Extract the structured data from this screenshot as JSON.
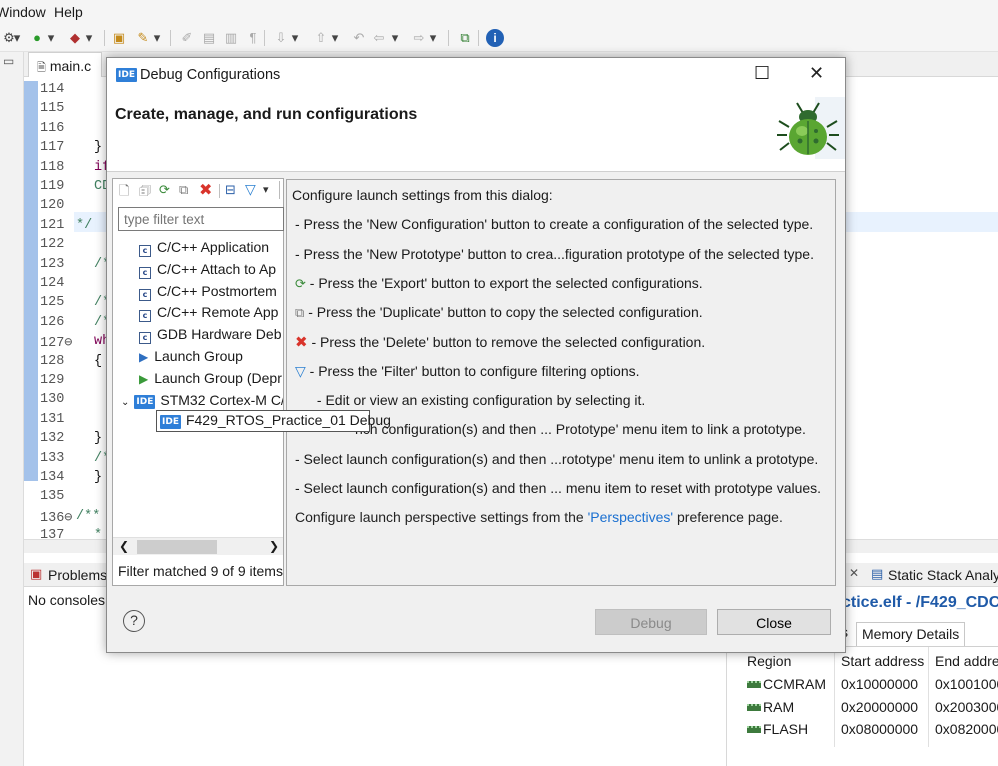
{
  "menu": {
    "window": "Window",
    "help": "Help"
  },
  "editor": {
    "tab": "main.c",
    "lines": [
      {
        "n": "114",
        "code": ""
      },
      {
        "n": "115",
        "code": ""
      },
      {
        "n": "116",
        "code": ""
      },
      {
        "n": "117",
        "code": "}"
      },
      {
        "n": "118",
        "code": "if"
      },
      {
        "n": "119",
        "code": "CD"
      },
      {
        "n": "120",
        "code": ""
      },
      {
        "n": "121",
        "code": "*/"
      },
      {
        "n": "122",
        "code": ""
      },
      {
        "n": "123",
        "code": "/*"
      },
      {
        "n": "124",
        "code": ""
      },
      {
        "n": "125",
        "code": "/*"
      },
      {
        "n": "126",
        "code": "/*"
      },
      {
        "n": "127⊖",
        "code": "wh"
      },
      {
        "n": "128",
        "code": "{"
      },
      {
        "n": "129",
        "code": ""
      },
      {
        "n": "130",
        "code": ""
      },
      {
        "n": "131",
        "code": ""
      },
      {
        "n": "132",
        "code": "}"
      },
      {
        "n": "133",
        "code": "/*"
      },
      {
        "n": "134",
        "code": "}"
      },
      {
        "n": "135",
        "code": ""
      },
      {
        "n": "136⊖",
        "code": "/**"
      },
      {
        "n": "137",
        "code": "*"
      }
    ]
  },
  "bottom_left": {
    "tab": "Problems",
    "message": "No consoles"
  },
  "bottom_right": {
    "tab": "Static Stack Analy",
    "title": "ctice.elf - /F429_CDC",
    "subtabs": [
      "s",
      "Memory Details"
    ],
    "headers": [
      "Region",
      "Start address",
      "End addre"
    ],
    "rows": [
      [
        "CCMRAM",
        "0x10000000",
        "0x1001000"
      ],
      [
        "RAM",
        "0x20000000",
        "0x2003000"
      ],
      [
        "FLASH",
        "0x08000000",
        "0x0820000"
      ]
    ]
  },
  "dialog": {
    "title": "Debug Configurations",
    "header": "Create, manage, and run configurations",
    "filter_placeholder": "type filter text",
    "tree": [
      {
        "label": "C/C++ Application",
        "kind": "cfg"
      },
      {
        "label": "C/C++ Attach to Ap",
        "kind": "cfg"
      },
      {
        "label": "C/C++ Postmortem",
        "kind": "cfg"
      },
      {
        "label": "C/C++ Remote App",
        "kind": "cfg"
      },
      {
        "label": "GDB Hardware Deb",
        "kind": "cfg"
      },
      {
        "label": "Launch Group",
        "kind": "launch"
      },
      {
        "label": "Launch Group (Depr",
        "kind": "launch2"
      },
      {
        "label": "STM32 Cortex-M C/",
        "kind": "ide"
      }
    ],
    "selected_item": "F429_RTOS_Practice_01 Debug",
    "filter_status": "Filter matched 9 of 9 items",
    "info": [
      "Configure launch settings from this dialog:",
      "- Press the 'New Configuration' button to create a configuration of the selected type.",
      "- Press the 'New Prototype' button to crea...figuration prototype of the selected type.",
      "- Press the 'Export' button to export the selected configurations.",
      "- Press the 'Duplicate' button to copy the selected configuration.",
      "- Press the 'Delete' button to remove the selected configuration.",
      "- Press the 'Filter' button to configure filtering options.",
      "- Edit or view an existing configuration by selecting it.",
      "nch configuration(s) and then ... Prototype' menu item to link a prototype.",
      "- Select launch configuration(s) and then ...rototype' menu item to unlink a prototype.",
      "- Select launch configuration(s) and then ... menu item to reset with prototype values.",
      "Configure launch perspective settings from the 'Perspectives' preference page."
    ],
    "debug_button": "Debug",
    "close_button": "Close",
    "help_glyph": "?"
  },
  "colors": {
    "accent": "#2f7fd8",
    "gutter": "#5a8fd8",
    "delete": "#d9342b"
  }
}
